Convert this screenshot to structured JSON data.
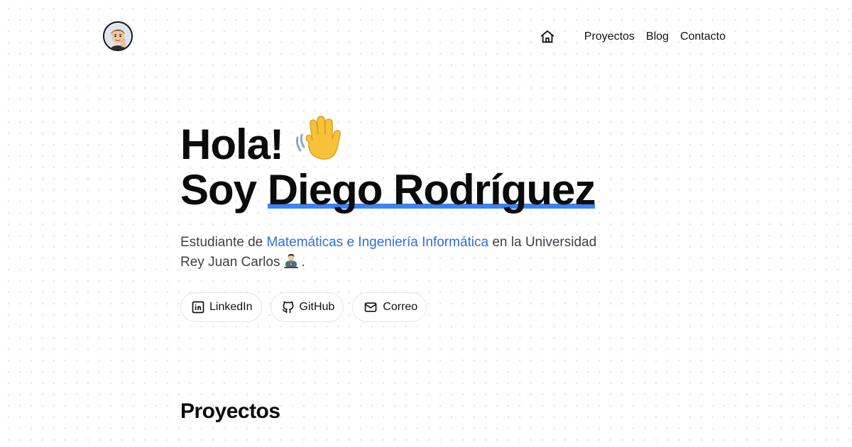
{
  "header": {
    "avatar_icon": "memoji-avatar",
    "nav": {
      "home_icon": "home-icon",
      "links": [
        "Proyectos",
        "Blog",
        "Contacto"
      ]
    }
  },
  "hero": {
    "greeting": "Hola!",
    "greeting_emoji": "waving-hand-icon",
    "intro_prefix": "Soy",
    "name": "Diego Rodríguez",
    "accent_color": "#3b82f6"
  },
  "intro": {
    "text_before": "Estudiante de",
    "highlight": "Matemáticas e Ingeniería Informática",
    "text_after": "en la Universidad Rey Juan Carlos",
    "emoji": "technologist-laptop-icon",
    "end": ".",
    "highlight_color": "#2f6fd6"
  },
  "socials": [
    {
      "label": "LinkedIn",
      "icon": "linkedin-icon"
    },
    {
      "label": "GitHub",
      "icon": "github-icon"
    },
    {
      "label": "Correo",
      "icon": "mail-icon"
    }
  ],
  "sections": {
    "projects_title": "Proyectos"
  }
}
